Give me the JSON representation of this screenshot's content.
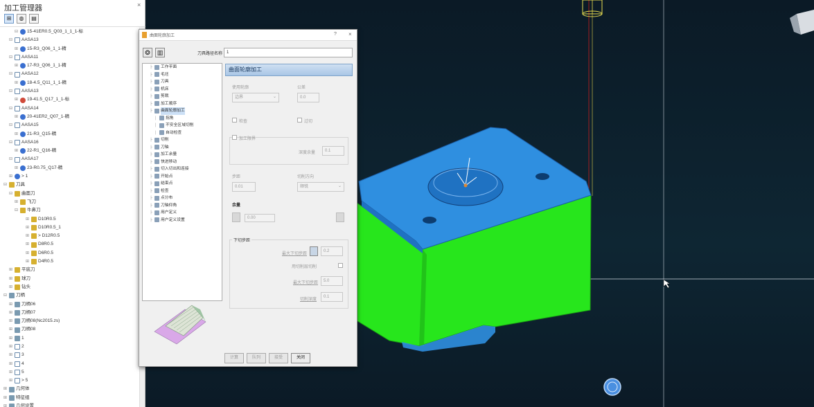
{
  "explorer": {
    "title": "加工管理器",
    "close_glyph": "×",
    "tree": [
      {
        "indent": 2,
        "tog": "⊟",
        "icon": "b",
        "label": "15-41ER0.5_Q03_1_1_1-标"
      },
      {
        "indent": 1,
        "tog": "⊟",
        "icon": "c",
        "label": "AASA13"
      },
      {
        "indent": 2,
        "tog": "⊞",
        "icon": "b",
        "label": "15-R3_Q06_1_1-精"
      },
      {
        "indent": 1,
        "tog": "⊟",
        "icon": "c",
        "label": "AASA11"
      },
      {
        "indent": 2,
        "tog": "⊞",
        "icon": "b",
        "label": "17-R3_Q06_1_1-精"
      },
      {
        "indent": 1,
        "tog": "⊟",
        "icon": "c",
        "label": "AASA12"
      },
      {
        "indent": 2,
        "tog": "⊞",
        "icon": "b",
        "label": "18-4.5_Q11_1_1-精"
      },
      {
        "indent": 1,
        "tog": "⊟",
        "icon": "c",
        "label": "AASA13"
      },
      {
        "indent": 2,
        "tog": "⊞",
        "icon": "r",
        "label": "19-41.5_Q17_1_1-标"
      },
      {
        "indent": 1,
        "tog": "⊟",
        "icon": "c",
        "label": "AASA14"
      },
      {
        "indent": 2,
        "tog": "⊞",
        "icon": "b",
        "label": "20-41ER2_Q07_1-精"
      },
      {
        "indent": 1,
        "tog": "⊟",
        "icon": "c",
        "label": "AASA15"
      },
      {
        "indent": 2,
        "tog": "⊞",
        "icon": "b",
        "label": "21-R3_Q15-精"
      },
      {
        "indent": 1,
        "tog": "⊟",
        "icon": "c",
        "label": "AASA16"
      },
      {
        "indent": 2,
        "tog": "⊞",
        "icon": "b",
        "label": "22-R1_Q16-精"
      },
      {
        "indent": 1,
        "tog": "⊟",
        "icon": "c",
        "label": "AASA17"
      },
      {
        "indent": 2,
        "tog": "⊞",
        "icon": "b",
        "label": "23-R0.75_Q17-精"
      },
      {
        "indent": 1,
        "tog": "⊞",
        "icon": "b",
        "label": "> 1"
      },
      {
        "indent": 0,
        "tog": "⊟",
        "icon": "y",
        "label": "刀具"
      },
      {
        "indent": 1,
        "tog": "⊟",
        "icon": "y",
        "label": "曲面刀"
      },
      {
        "indent": 2,
        "tog": "⊞",
        "icon": "y",
        "label": "飞刀"
      },
      {
        "indent": 2,
        "tog": "⊟",
        "icon": "y",
        "label": "牛鼻刀"
      },
      {
        "indent": 4,
        "tog": "⊞",
        "icon": "y",
        "label": "D10R0.5"
      },
      {
        "indent": 4,
        "tog": "⊞",
        "icon": "y",
        "label": "D10R0.5_1"
      },
      {
        "indent": 4,
        "tog": "⊞",
        "icon": "y",
        "label": "> D12R0.5"
      },
      {
        "indent": 4,
        "tog": "⊞",
        "icon": "y",
        "label": "D8R0.5"
      },
      {
        "indent": 4,
        "tog": "⊞",
        "icon": "y",
        "label": "D6R0.5"
      },
      {
        "indent": 4,
        "tog": "⊞",
        "icon": "y",
        "label": "D4R0.5"
      },
      {
        "indent": 1,
        "tog": "⊞",
        "icon": "y",
        "label": "平底刀"
      },
      {
        "indent": 1,
        "tog": "⊞",
        "icon": "y",
        "label": "球刀"
      },
      {
        "indent": 1,
        "tog": "⊞",
        "icon": "y",
        "label": "钻头"
      },
      {
        "indent": 0,
        "tog": "⊟",
        "icon": "g",
        "label": "刀柄"
      },
      {
        "indent": 1,
        "tog": "⊞",
        "icon": "g",
        "label": "刀柄06"
      },
      {
        "indent": 1,
        "tog": "⊞",
        "icon": "g",
        "label": "刀柄07"
      },
      {
        "indent": 1,
        "tog": "⊞",
        "icon": "g",
        "label": "刀柄08(Nc2015.zs)"
      },
      {
        "indent": 1,
        "tog": "⊞",
        "icon": "g",
        "label": "刀柄08"
      },
      {
        "indent": 1,
        "tog": "⊞",
        "icon": "g",
        "label": "1"
      },
      {
        "indent": 1,
        "tog": "⊞",
        "icon": "c",
        "label": "2"
      },
      {
        "indent": 1,
        "tog": "⊞",
        "icon": "c",
        "label": "3"
      },
      {
        "indent": 1,
        "tog": "⊞",
        "icon": "c",
        "label": "4"
      },
      {
        "indent": 1,
        "tog": "⊞",
        "icon": "c",
        "label": "5"
      },
      {
        "indent": 1,
        "tog": "⊞",
        "icon": "c",
        "label": "> 5"
      },
      {
        "indent": 0,
        "tog": "⊞",
        "icon": "g",
        "label": "几何体"
      },
      {
        "indent": 0,
        "tog": "⊞",
        "icon": "g",
        "label": "特征组"
      },
      {
        "indent": 0,
        "tog": "⊞",
        "icon": "g",
        "label": "几何设置"
      },
      {
        "indent": 0,
        "tog": "⊞",
        "icon": "g",
        "label": "工作坐标"
      }
    ]
  },
  "dialog": {
    "title": "曲面轮廓加工",
    "help_glyph": "?",
    "close_glyph": "×",
    "path_name_label": "刀具路径名称",
    "path_name_value": "1",
    "nav": [
      {
        "indent": 1,
        "label": "工作平面"
      },
      {
        "indent": 1,
        "label": "毛坯"
      },
      {
        "indent": 1,
        "label": "刀具"
      },
      {
        "indent": 1,
        "label": "机床"
      },
      {
        "indent": 1,
        "label": "剪裁"
      },
      {
        "indent": 1,
        "label": "加工顺序"
      },
      {
        "indent": 1,
        "label": "曲面轮廓加工",
        "selected": true
      },
      {
        "indent": 2,
        "label": "拐角"
      },
      {
        "indent": 2,
        "label": "不安全区域切削"
      },
      {
        "indent": 2,
        "label": "自动检查"
      },
      {
        "indent": 1,
        "label": "切削"
      },
      {
        "indent": 1,
        "label": "刀轴"
      },
      {
        "indent": 1,
        "label": "加工余量"
      },
      {
        "indent": 1,
        "label": "快进移动"
      },
      {
        "indent": 1,
        "label": "切入切出和连接"
      },
      {
        "indent": 1,
        "label": "开始点"
      },
      {
        "indent": 1,
        "label": "结束点"
      },
      {
        "indent": 1,
        "label": "检查"
      },
      {
        "indent": 1,
        "label": "点分布"
      },
      {
        "indent": 1,
        "label": "刀轴仰角"
      },
      {
        "indent": 1,
        "label": "用户定义"
      },
      {
        "indent": 1,
        "label": "用户定义设置"
      }
    ],
    "panel_title": "曲面轮廓加工",
    "contour_label": "使用轮廓",
    "contour_value": "边界",
    "tolerance_label": "公差",
    "tolerance_value": "0.0",
    "check1_label": "检查",
    "check2_label": "过切",
    "limit_group_label": "加工限界",
    "limit_field_label": "深度余量",
    "limit_field_value": "0.1",
    "stepover_label": "步距",
    "stepover_value": "0.01",
    "direction_label": "切削方向",
    "direction_value": "顺铣",
    "margin_label": "余量",
    "margin_value": "0.00",
    "step_group_label": "下切步距",
    "step1_label": "最大下切步距",
    "step1_value": "0.2",
    "check_label": "用切削层切削",
    "step2_label": "最大下切步距",
    "step2_value": "5.0",
    "step3_label": "切削深度",
    "step3_value": "0.1",
    "btn_calc": "计算",
    "btn_queue": "队列",
    "btn_ok": "接受",
    "btn_cancel": "关闭"
  },
  "colors": {
    "top_face": "#2f8fe0",
    "side_face": "#27e61c",
    "axis_red": "#c81e1e"
  }
}
